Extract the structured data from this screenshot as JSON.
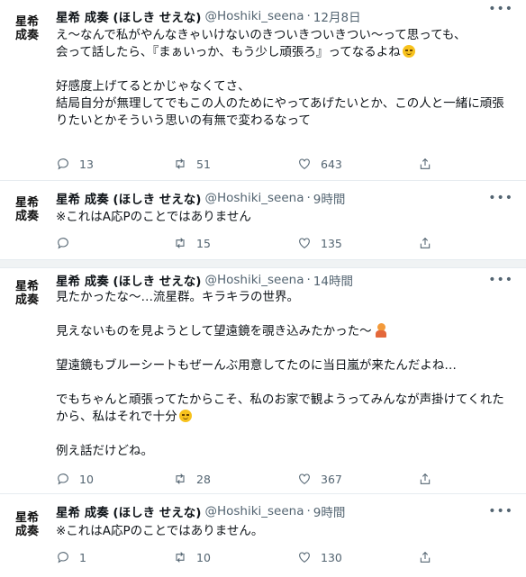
{
  "tweets": [
    {
      "avatar_line1": "星希",
      "avatar_line2": "成奏",
      "name": "星希 成奏 (ほしき せえな)",
      "handle": "@Hoshiki_seena",
      "time": "12月8日",
      "lines": [
        "え〜なんで私がやんなきゃいけないのきついきついきつい〜って思っても、",
        "会って話したら、『まぁいっか、もう少し頑張ろ』ってなるよね",
        "",
        "好感度上げてるとかじゃなくてさ、",
        "結局自分が無理してでもこの人のためにやってあげたいとか、この人と一緒に頑張りたいとかそういう思いの有無で変わるなって"
      ],
      "replies": "13",
      "retweets": "51",
      "likes": "643"
    },
    {
      "avatar_line1": "星希",
      "avatar_line2": "成奏",
      "name": "星希 成奏 (ほしき せえな)",
      "handle": "@Hoshiki_seena",
      "time": "9時間",
      "lines": [
        "※これはA応Pのことではありません"
      ],
      "replies": "",
      "retweets": "15",
      "likes": "135"
    },
    {
      "avatar_line1": "星希",
      "avatar_line2": "成奏",
      "name": "星希 成奏 (ほしき せえな)",
      "handle": "@Hoshiki_seena",
      "time": "14時間",
      "lines": [
        "見たかったな〜…流星群。キラキラの世界。",
        "",
        "見えないものを見ようとして望遠鏡を覗き込みたかった〜",
        "",
        "望遠鏡もブルーシートもぜーんぶ用意してたのに当日嵐が来たんだよね…",
        "",
        "でもちゃんと頑張ってたからこそ、私のお家で観ようってみんなが声掛けてくれたから、私はそれで十分",
        "",
        "例え話だけどね。"
      ],
      "replies": "10",
      "retweets": "28",
      "likes": "367"
    },
    {
      "avatar_line1": "星希",
      "avatar_line2": "成奏",
      "name": "星希 成奏 (ほしき せえな)",
      "handle": "@Hoshiki_seena",
      "time": "9時間",
      "lines": [
        "※これはA応Pのことではありません。"
      ],
      "replies": "1",
      "retweets": "10",
      "likes": "130"
    }
  ],
  "icons": {
    "more": "more-horizontal-icon",
    "reply": "reply-icon",
    "retweet": "retweet-icon",
    "like": "heart-icon",
    "share": "share-icon",
    "emoji_relieved": "relieved-face-emoji",
    "emoji_gesture": "person-gesturing-emoji"
  },
  "colors": {
    "text": "#0f1419",
    "secondary": "#536471",
    "separator": "#f0f3f4"
  }
}
